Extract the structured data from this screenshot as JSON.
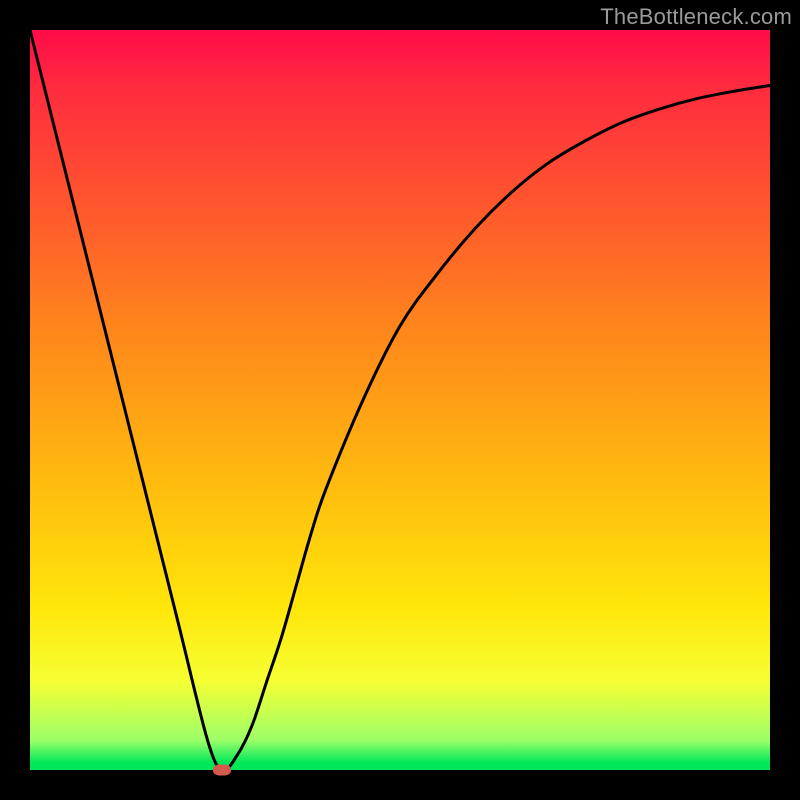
{
  "watermark": "TheBottleneck.com",
  "chart_data": {
    "type": "line",
    "title": "",
    "xlabel": "",
    "ylabel": "",
    "xlim": [
      0,
      100
    ],
    "ylim": [
      0,
      100
    ],
    "grid": false,
    "legend": false,
    "series": [
      {
        "name": "curve",
        "x": [
          0,
          5,
          10,
          15,
          20,
          24,
          26,
          28,
          30,
          32,
          34,
          36,
          38,
          40,
          45,
          50,
          55,
          60,
          65,
          70,
          75,
          80,
          85,
          90,
          95,
          100
        ],
        "y": [
          100,
          80,
          60,
          40,
          20,
          4,
          0,
          2,
          6,
          12,
          18,
          25,
          32,
          38,
          50,
          60,
          67,
          73,
          78,
          82,
          85,
          87.5,
          89.3,
          90.7,
          91.7,
          92.5
        ]
      }
    ],
    "marker": {
      "x": 26,
      "y": 0,
      "color": "#d45a4d"
    },
    "background_gradient": {
      "top": "#ff0b49",
      "mid": "#ffc400",
      "bottom": "#00e85a"
    }
  }
}
